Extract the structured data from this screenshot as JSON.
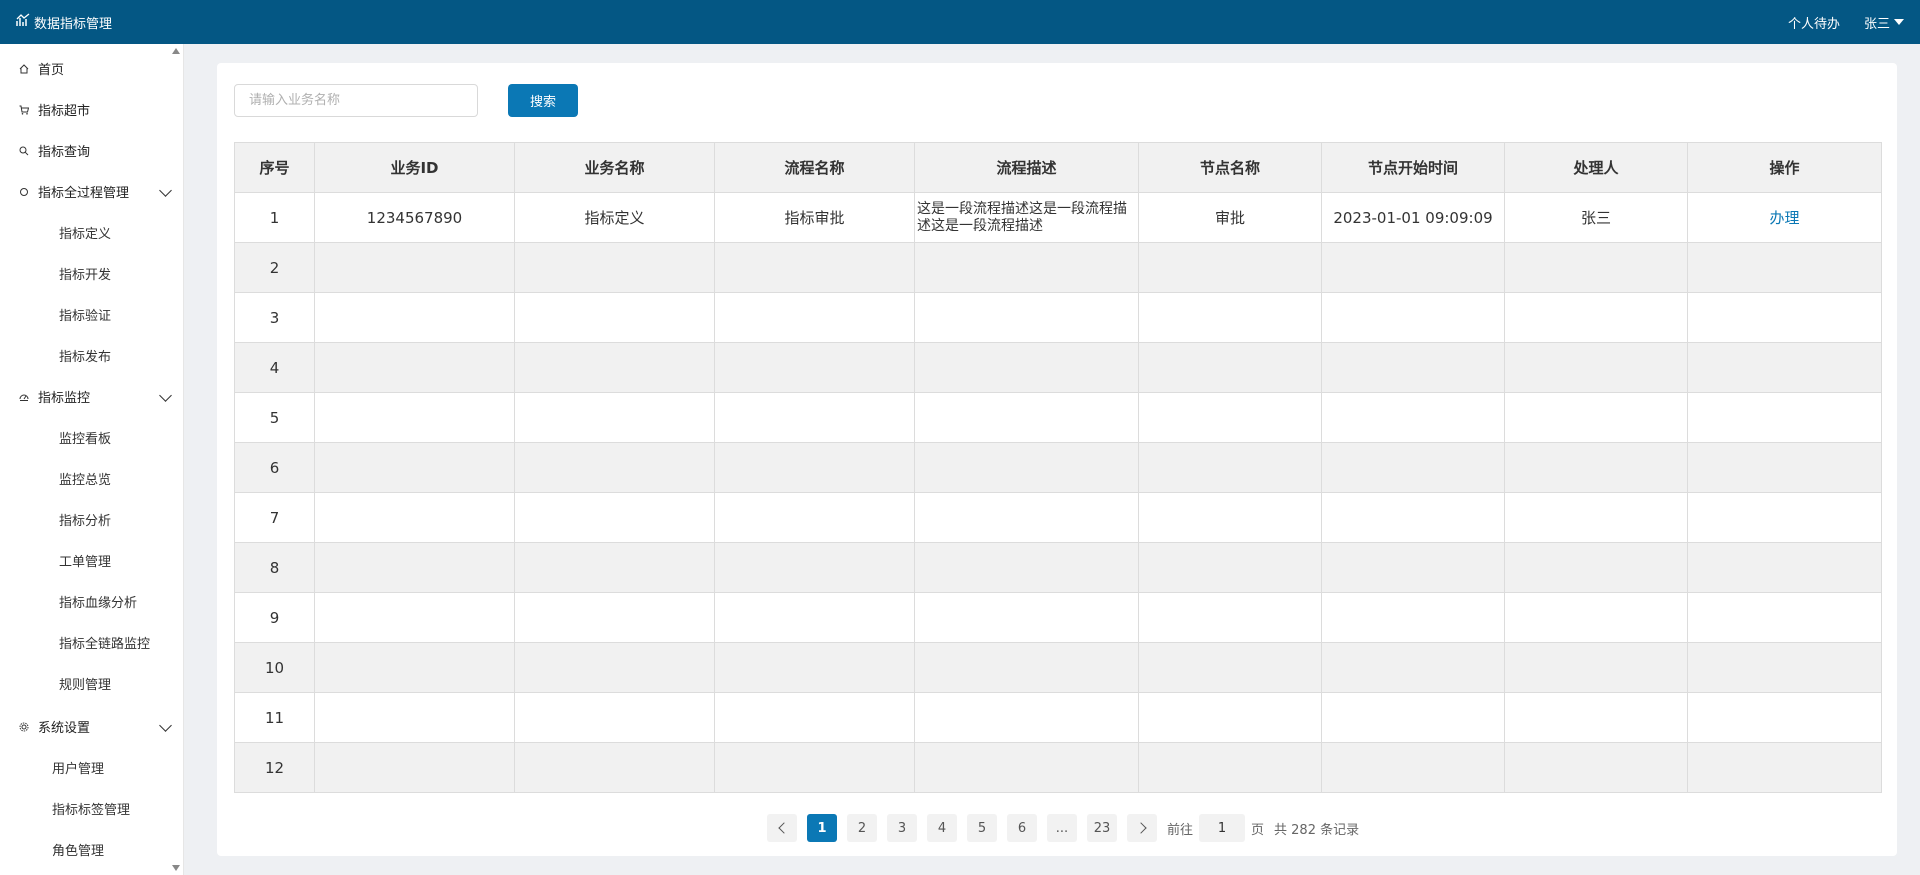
{
  "header": {
    "title": "数据指标管理",
    "todo": "个人待办",
    "user": "张三"
  },
  "sidebar": {
    "items": [
      {
        "label": "首页",
        "icon": "home-icon"
      },
      {
        "label": "指标超市",
        "icon": "cart-icon"
      },
      {
        "label": "指标查询",
        "icon": "search-icon"
      },
      {
        "label": "指标全过程管理",
        "icon": "circle-icon",
        "children": [
          "指标定义",
          "指标开发",
          "指标验证",
          "指标发布"
        ]
      },
      {
        "label": "指标监控",
        "icon": "monitor-icon",
        "children": [
          "监控看板",
          "监控总览",
          "指标分析",
          "工单管理",
          "指标血缘分析",
          "指标全链路监控",
          "规则管理"
        ]
      },
      {
        "label": "系统设置",
        "icon": "gear-icon",
        "children": [
          "用户管理",
          "指标标签管理",
          "角色管理"
        ]
      }
    ]
  },
  "search": {
    "placeholder": "请输入业务名称",
    "button": "搜索"
  },
  "table": {
    "headers": [
      "序号",
      "业务ID",
      "业务名称",
      "流程名称",
      "流程描述",
      "节点名称",
      "节点开始时间",
      "处理人",
      "操作"
    ],
    "rows": [
      [
        "1",
        "1234567890",
        "指标定义",
        "指标审批",
        "这是一段流程描述这是一段流程描述这是一段流程描述",
        "审批",
        "2023-01-01  09:09:09",
        "张三",
        "办理"
      ],
      [
        "2",
        "",
        "",
        "",
        "",
        "",
        "",
        "",
        ""
      ],
      [
        "3",
        "",
        "",
        "",
        "",
        "",
        "",
        "",
        ""
      ],
      [
        "4",
        "",
        "",
        "",
        "",
        "",
        "",
        "",
        ""
      ],
      [
        "5",
        "",
        "",
        "",
        "",
        "",
        "",
        "",
        ""
      ],
      [
        "6",
        "",
        "",
        "",
        "",
        "",
        "",
        "",
        ""
      ],
      [
        "7",
        "",
        "",
        "",
        "",
        "",
        "",
        "",
        ""
      ],
      [
        "8",
        "",
        "",
        "",
        "",
        "",
        "",
        "",
        ""
      ],
      [
        "9",
        "",
        "",
        "",
        "",
        "",
        "",
        "",
        ""
      ],
      [
        "10",
        "",
        "",
        "",
        "",
        "",
        "",
        "",
        ""
      ],
      [
        "11",
        "",
        "",
        "",
        "",
        "",
        "",
        "",
        ""
      ],
      [
        "12",
        "",
        "",
        "",
        "",
        "",
        "",
        "",
        ""
      ]
    ]
  },
  "pagination": {
    "pages": [
      "1",
      "2",
      "3",
      "4",
      "5",
      "6",
      "...",
      "23"
    ],
    "current": "1",
    "goto_prefix": "前往",
    "goto_value": "1",
    "goto_suffix": "页",
    "total": "共 282 条记录"
  },
  "colors": {
    "header_bg": "#045784",
    "accent": "#0b78b5"
  }
}
